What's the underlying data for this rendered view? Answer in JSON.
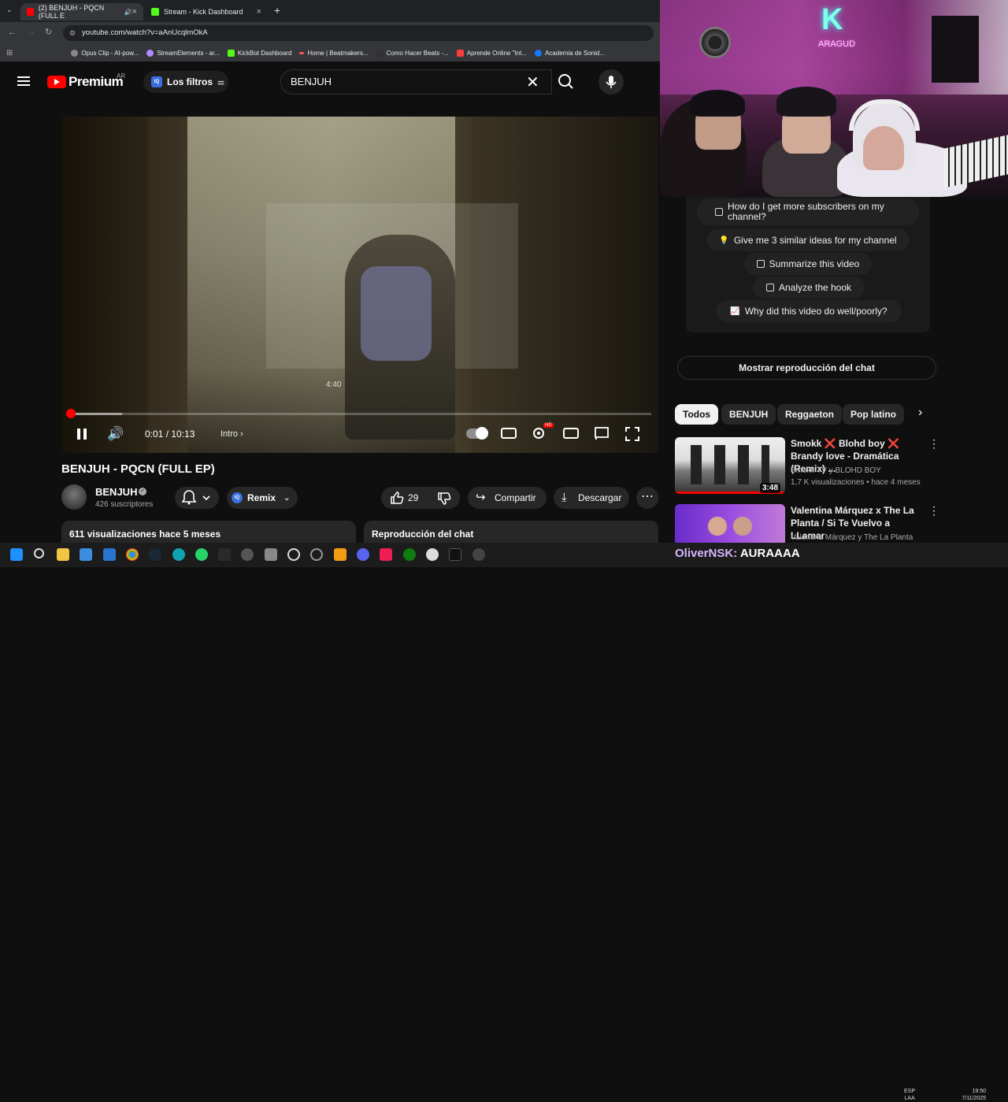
{
  "browser": {
    "tabs": [
      {
        "title": "(2) BENJUH - PQCN (FULL E",
        "active": true,
        "favicon_color": "#ff0000"
      },
      {
        "title": "Stream - Kick Dashboard",
        "active": false,
        "favicon_color": "#53fc18"
      }
    ],
    "new_tab": "+",
    "url": "youtube.com/watch?v=aAnUcqlmOkA",
    "bookmarks": [
      {
        "label": "Opus Clip - AI-pow...",
        "color": "#888"
      },
      {
        "label": "StreamElements - ar...",
        "color": "#b388ff"
      },
      {
        "label": "KickBot Dashboard",
        "color": "#53fc18"
      },
      {
        "label": "Home | Beatmakers...",
        "color": "#ff5252"
      },
      {
        "label": "Como Hacer Beats -...",
        "color": "#333"
      },
      {
        "label": "Aprende Online \"Int...",
        "color": "#ff3d3d"
      },
      {
        "label": "Academia de Sonid...",
        "color": "#1877f2"
      }
    ]
  },
  "youtube": {
    "brand": "Premium",
    "region": "AR",
    "filters_label": "Los filtros",
    "search_value": "BENJUH",
    "search_clear": "✕"
  },
  "player": {
    "hover_time": "4:40",
    "time": "0:01 / 10:13",
    "chapter": "Intro",
    "progress_fraction": 0.002,
    "buffer_fraction": 0.09,
    "hd_badge": "HD"
  },
  "video": {
    "title": "BENJUH - PQCN (FULL EP)",
    "channel": "BENJUH",
    "subscribers": "426 suscriptores",
    "remix_label": "Remix",
    "likes": "29",
    "share_label": "Compartir",
    "download_label": "Descargar",
    "description_meta": "611 visualizaciones  hace 5 meses",
    "chat_replay_title": "Reproducción del chat"
  },
  "webcam": {
    "sign_letter": "K",
    "sign_text": "ARAGUD"
  },
  "ai_suggestions": [
    {
      "label": "How do I get more subscribers on my channel?",
      "icon": "video-icon"
    },
    {
      "label": "Give me 3 similar ideas for my channel",
      "icon": "bulb-icon"
    },
    {
      "label": "Summarize this video",
      "icon": "doc-icon"
    },
    {
      "label": "Analyze the hook",
      "icon": "video-icon"
    },
    {
      "label": "Why did this video do well/poorly?",
      "icon": "chart-icon"
    }
  ],
  "sidebar": {
    "chat_replay_button": "Mostrar reproducción del chat",
    "chips": [
      "Todos",
      "BENJUH",
      "Reggaeton",
      "Pop latino"
    ],
    "recommendations": [
      {
        "title": "Smokk ❌ Blohd boy ❌ Brandy love - Dramática (Remix) ...",
        "channel": "Smokk TV y BLOHD BOY",
        "meta": "1,7 K visualizaciones • hace 4 meses",
        "duration": "3:48"
      },
      {
        "title": "Valentina Márquez x The La Planta / Si Te Vuelvo a LLamar",
        "channel": "Valentina Márquez y The La Planta",
        "meta": "",
        "duration": ""
      }
    ]
  },
  "stream_overlay": {
    "username": "OliverNSK:",
    "message": "AURAAAA"
  },
  "taskbar": {
    "lang": "ESP",
    "lang2": "LAA",
    "time": "19:50",
    "date": "7/11/2025"
  },
  "colors": {
    "youtube_red": "#ff0000",
    "kick_green": "#53fc18",
    "background": "#0f0f0f"
  }
}
